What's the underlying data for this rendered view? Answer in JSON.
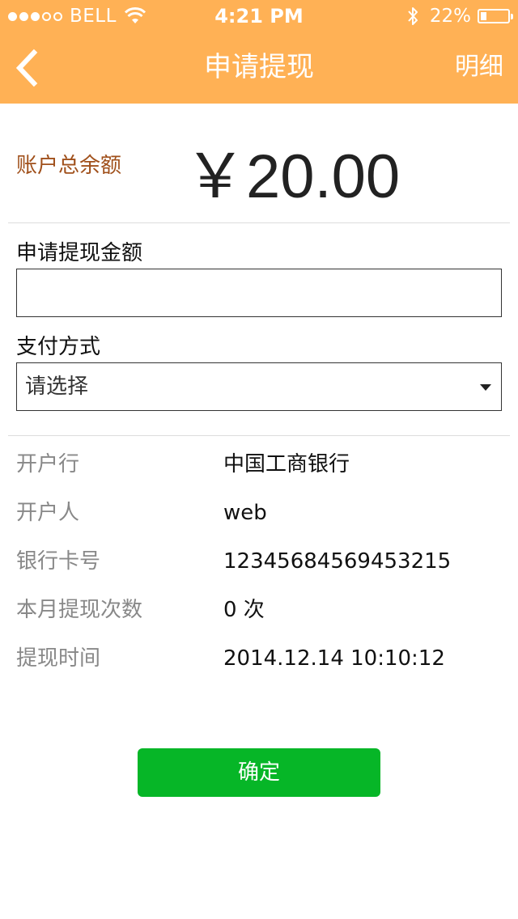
{
  "status_bar": {
    "carrier": "BELL",
    "time": "4:21 PM",
    "battery_percent": "22%",
    "battery_level": 0.22,
    "signal_bars_filled": 3,
    "signal_bars_total": 5
  },
  "nav": {
    "title": "申请提现",
    "detail_label": "明细",
    "back_icon": "chevron-left-icon"
  },
  "balance": {
    "label": "账户总余额",
    "amount": "￥20.00"
  },
  "form": {
    "amount_label": "申请提现金额",
    "amount_value": "",
    "payment_label": "支付方式",
    "payment_selected": "请选择"
  },
  "info": {
    "rows": [
      {
        "label": "开户行",
        "value": "中国工商银行"
      },
      {
        "label": "开户人",
        "value": "web"
      },
      {
        "label": "银行卡号",
        "value": "12345684569453215"
      },
      {
        "label": "本月提现次数",
        "value": "0 次"
      },
      {
        "label": "提现时间",
        "value": "2014.12.14 10:10:12"
      }
    ]
  },
  "confirm_label": "确定",
  "colors": {
    "header_bg": "#ffb155",
    "balance_label": "#a0501b",
    "confirm_bg": "#06b627"
  }
}
